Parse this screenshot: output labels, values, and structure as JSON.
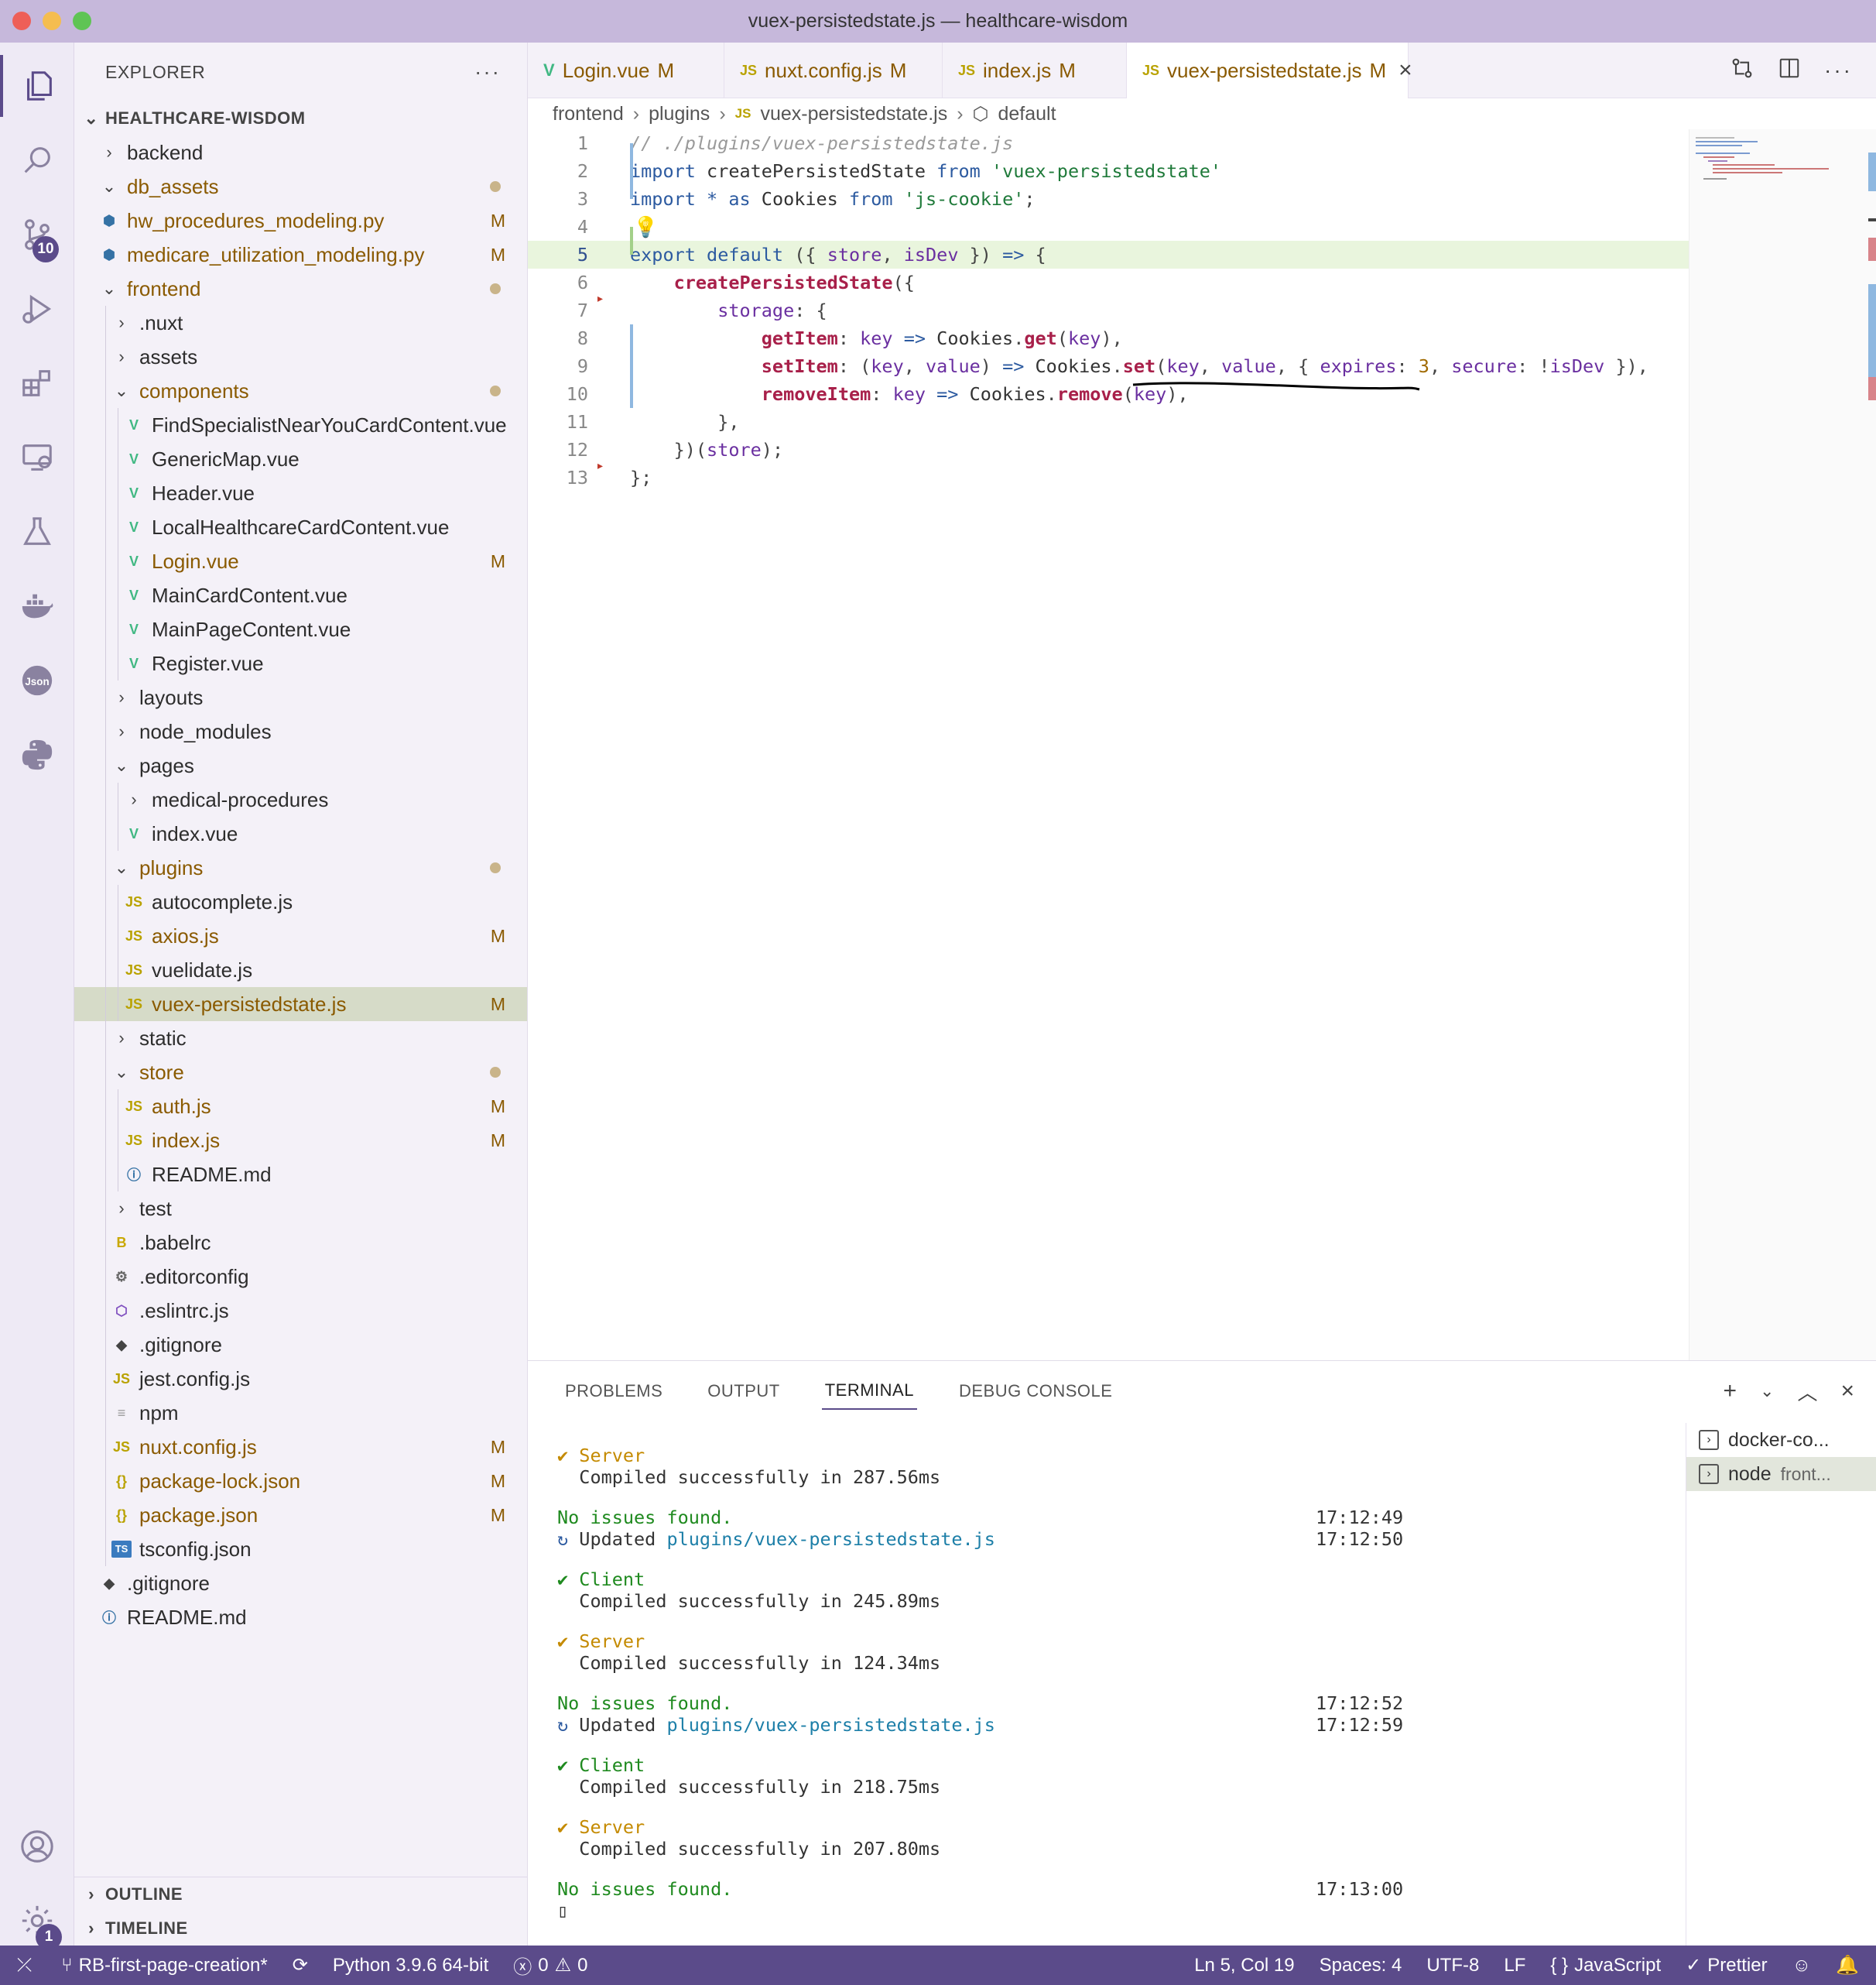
{
  "window": {
    "title": "vuex-persistedstate.js — healthcare-wisdom"
  },
  "activity": {
    "scm_badge": "10",
    "manage_badge": "1"
  },
  "sidebar": {
    "explorer_label": "EXPLORER",
    "more": "···",
    "root": "HEALTHCARE-WISDOM",
    "tree": [
      {
        "name": "backend",
        "type": "folder",
        "open": false,
        "depth": 1
      },
      {
        "name": "db_assets",
        "type": "folder",
        "open": true,
        "depth": 1,
        "mod": true,
        "dot": true
      },
      {
        "name": "hw_procedures_modeling.py",
        "type": "py",
        "depth": 1,
        "mod": true,
        "status": "M"
      },
      {
        "name": "medicare_utilization_modeling.py",
        "type": "py",
        "depth": 1,
        "mod": true,
        "status": "M"
      },
      {
        "name": "frontend",
        "type": "folder",
        "open": true,
        "depth": 1,
        "mod": true,
        "dot": true
      },
      {
        "name": ".nuxt",
        "type": "folder",
        "open": false,
        "depth": 2
      },
      {
        "name": "assets",
        "type": "folder",
        "open": false,
        "depth": 2
      },
      {
        "name": "components",
        "type": "folder",
        "open": true,
        "depth": 2,
        "mod": true,
        "dot": true
      },
      {
        "name": "FindSpecialistNearYouCardContent.vue",
        "type": "vue",
        "depth": 3
      },
      {
        "name": "GenericMap.vue",
        "type": "vue",
        "depth": 3
      },
      {
        "name": "Header.vue",
        "type": "vue",
        "depth": 3
      },
      {
        "name": "LocalHealthcareCardContent.vue",
        "type": "vue",
        "depth": 3
      },
      {
        "name": "Login.vue",
        "type": "vue",
        "depth": 3,
        "mod": true,
        "status": "M"
      },
      {
        "name": "MainCardContent.vue",
        "type": "vue",
        "depth": 3
      },
      {
        "name": "MainPageContent.vue",
        "type": "vue",
        "depth": 3
      },
      {
        "name": "Register.vue",
        "type": "vue",
        "depth": 3
      },
      {
        "name": "layouts",
        "type": "folder",
        "open": false,
        "depth": 2
      },
      {
        "name": "node_modules",
        "type": "folder",
        "open": false,
        "depth": 2
      },
      {
        "name": "pages",
        "type": "folder",
        "open": true,
        "depth": 2
      },
      {
        "name": "medical-procedures",
        "type": "folder",
        "open": false,
        "depth": 3
      },
      {
        "name": "index.vue",
        "type": "vue",
        "depth": 3
      },
      {
        "name": "plugins",
        "type": "folder",
        "open": true,
        "depth": 2,
        "mod": true,
        "dot": true
      },
      {
        "name": "autocomplete.js",
        "type": "js",
        "depth": 3
      },
      {
        "name": "axios.js",
        "type": "js",
        "depth": 3,
        "mod": true,
        "status": "M"
      },
      {
        "name": "vuelidate.js",
        "type": "js",
        "depth": 3
      },
      {
        "name": "vuex-persistedstate.js",
        "type": "js",
        "depth": 3,
        "mod": true,
        "status": "M",
        "selected": true
      },
      {
        "name": "static",
        "type": "folder",
        "open": false,
        "depth": 2
      },
      {
        "name": "store",
        "type": "folder",
        "open": true,
        "depth": 2,
        "mod": true,
        "dot": true
      },
      {
        "name": "auth.js",
        "type": "js",
        "depth": 3,
        "mod": true,
        "status": "M"
      },
      {
        "name": "index.js",
        "type": "js",
        "depth": 3,
        "mod": true,
        "status": "M"
      },
      {
        "name": "README.md",
        "type": "info",
        "depth": 3
      },
      {
        "name": "test",
        "type": "folder",
        "open": false,
        "depth": 2
      },
      {
        "name": ".babelrc",
        "type": "babel",
        "depth": 2
      },
      {
        "name": ".editorconfig",
        "type": "gear",
        "depth": 2
      },
      {
        "name": ".eslintrc.js",
        "type": "eslint",
        "depth": 2
      },
      {
        "name": ".gitignore",
        "type": "git",
        "depth": 2
      },
      {
        "name": "jest.config.js",
        "type": "js",
        "depth": 2
      },
      {
        "name": "npm",
        "type": "text",
        "depth": 2
      },
      {
        "name": "nuxt.config.js",
        "type": "js",
        "depth": 2,
        "mod": true,
        "status": "M"
      },
      {
        "name": "package-lock.json",
        "type": "json",
        "depth": 2,
        "mod": true,
        "status": "M"
      },
      {
        "name": "package.json",
        "type": "json",
        "depth": 2,
        "mod": true,
        "status": "M"
      },
      {
        "name": "tsconfig.json",
        "type": "ts",
        "depth": 2
      },
      {
        "name": ".gitignore",
        "type": "git",
        "depth": 1
      },
      {
        "name": "README.md",
        "type": "info",
        "depth": 1
      }
    ],
    "outline": "OUTLINE",
    "timeline": "TIMELINE"
  },
  "tabs": [
    {
      "name": "Login.vue",
      "icon": "V",
      "kind": "vue",
      "status": "M",
      "active": false
    },
    {
      "name": "nuxt.config.js",
      "icon": "JS",
      "kind": "js",
      "status": "M",
      "active": false
    },
    {
      "name": "index.js",
      "icon": "JS",
      "kind": "js",
      "status": "M",
      "active": false
    },
    {
      "name": "vuex-persistedstate.js",
      "icon": "JS",
      "kind": "js",
      "status": "M",
      "active": true
    }
  ],
  "breadcrumb": {
    "p1": "frontend",
    "p2": "plugins",
    "p3_icon": "JS",
    "p3": "vuex-persistedstate.js",
    "p4": "default"
  },
  "editor": {
    "current_line": 5,
    "lines": [
      [
        [
          "com",
          "// ./plugins/vuex-persistedstate.js"
        ]
      ],
      [
        [
          "kw",
          "import "
        ],
        [
          "var",
          "createPersistedState "
        ],
        [
          "kw",
          "from "
        ],
        [
          "str",
          "'vuex-persistedstate'"
        ]
      ],
      [
        [
          "kw",
          "import "
        ],
        [
          "kw",
          "* "
        ],
        [
          "kw",
          "as "
        ],
        [
          "var",
          "Cookies "
        ],
        [
          "kw",
          "from "
        ],
        [
          "str",
          "'js-cookie'"
        ],
        [
          "punc",
          ";"
        ]
      ],
      [],
      [
        [
          "kw",
          "export "
        ],
        [
          "kw",
          "default "
        ],
        [
          "punc",
          "({ "
        ],
        [
          "prop",
          "store"
        ],
        [
          "punc",
          ", "
        ],
        [
          "prop",
          "isDev"
        ],
        [
          "punc",
          " }) "
        ],
        [
          "kw",
          "=> "
        ],
        [
          "punc",
          "{"
        ]
      ],
      [
        [
          "var",
          "    "
        ],
        [
          "fn",
          "createPersistedState"
        ],
        [
          "punc",
          "({"
        ]
      ],
      [
        [
          "var",
          "        "
        ],
        [
          "prop",
          "storage"
        ],
        [
          "punc",
          ": {"
        ]
      ],
      [
        [
          "var",
          "            "
        ],
        [
          "fn",
          "getItem"
        ],
        [
          "punc",
          ": "
        ],
        [
          "prop",
          "key "
        ],
        [
          "kw",
          "=> "
        ],
        [
          "var",
          "Cookies"
        ],
        [
          "punc",
          "."
        ],
        [
          "fn",
          "get"
        ],
        [
          "punc",
          "("
        ],
        [
          "prop",
          "key"
        ],
        [
          "punc",
          "),"
        ]
      ],
      [
        [
          "var",
          "            "
        ],
        [
          "fn",
          "setItem"
        ],
        [
          "punc",
          ": ("
        ],
        [
          "prop",
          "key"
        ],
        [
          "punc",
          ", "
        ],
        [
          "prop",
          "value"
        ],
        [
          "punc",
          ") "
        ],
        [
          "kw",
          "=> "
        ],
        [
          "var",
          "Cookies"
        ],
        [
          "punc",
          "."
        ],
        [
          "fn",
          "set"
        ],
        [
          "punc",
          "("
        ],
        [
          "prop",
          "key"
        ],
        [
          "punc",
          ", "
        ],
        [
          "prop",
          "value"
        ],
        [
          "punc",
          ", { "
        ],
        [
          "prop",
          "expires"
        ],
        [
          "punc",
          ": "
        ],
        [
          "num",
          "3"
        ],
        [
          "punc",
          ", "
        ],
        [
          "prop",
          "secure"
        ],
        [
          "punc",
          ": !"
        ],
        [
          "prop",
          "isDev"
        ],
        [
          "punc",
          " }),"
        ]
      ],
      [
        [
          "var",
          "            "
        ],
        [
          "fn",
          "removeItem"
        ],
        [
          "punc",
          ": "
        ],
        [
          "prop",
          "key "
        ],
        [
          "kw",
          "=> "
        ],
        [
          "var",
          "Cookies"
        ],
        [
          "punc",
          "."
        ],
        [
          "fn",
          "remove"
        ],
        [
          "punc",
          "("
        ],
        [
          "prop",
          "key"
        ],
        [
          "punc",
          "),"
        ]
      ],
      [
        [
          "var",
          "        "
        ],
        [
          "punc",
          "},"
        ]
      ],
      [
        [
          "var",
          "    "
        ],
        [
          "punc",
          "})("
        ],
        [
          "prop",
          "store"
        ],
        [
          "punc",
          ");"
        ]
      ],
      [
        [
          "punc",
          "};"
        ]
      ]
    ]
  },
  "panel": {
    "tabs": [
      "PROBLEMS",
      "OUTPUT",
      "TERMINAL",
      "DEBUG CONSOLE"
    ],
    "active_tab": "TERMINAL",
    "terminals": [
      {
        "name": "docker-co...",
        "active": false
      },
      {
        "name": "node",
        "sub": "front...",
        "active": true
      }
    ],
    "terminal_lines": [
      {
        "segments": [
          [
            "warn",
            "✔ Server"
          ]
        ],
        "time": ""
      },
      {
        "segments": [
          [
            "text",
            "  Compiled successfully in 287.56ms"
          ]
        ],
        "time": ""
      },
      {
        "segments": [],
        "time": ""
      },
      {
        "segments": [
          [
            "ok",
            "No issues found."
          ]
        ],
        "time": "17:12:49"
      },
      {
        "segments": [
          [
            "blue",
            "↻ "
          ],
          [
            "text",
            "Updated "
          ],
          [
            "link",
            "plugins/vuex-persistedstate.js"
          ]
        ],
        "time": "17:12:50"
      },
      {
        "segments": [],
        "time": ""
      },
      {
        "segments": [
          [
            "ok",
            "✔ Client"
          ]
        ],
        "time": ""
      },
      {
        "segments": [
          [
            "text",
            "  Compiled successfully in 245.89ms"
          ]
        ],
        "time": ""
      },
      {
        "segments": [],
        "time": ""
      },
      {
        "segments": [
          [
            "warn",
            "✔ Server"
          ]
        ],
        "time": ""
      },
      {
        "segments": [
          [
            "text",
            "  Compiled successfully in 124.34ms"
          ]
        ],
        "time": ""
      },
      {
        "segments": [],
        "time": ""
      },
      {
        "segments": [
          [
            "ok",
            "No issues found."
          ]
        ],
        "time": "17:12:52"
      },
      {
        "segments": [
          [
            "blue",
            "↻ "
          ],
          [
            "text",
            "Updated "
          ],
          [
            "link",
            "plugins/vuex-persistedstate.js"
          ]
        ],
        "time": "17:12:59"
      },
      {
        "segments": [],
        "time": ""
      },
      {
        "segments": [
          [
            "ok",
            "✔ Client"
          ]
        ],
        "time": ""
      },
      {
        "segments": [
          [
            "text",
            "  Compiled successfully in 218.75ms"
          ]
        ],
        "time": ""
      },
      {
        "segments": [],
        "time": ""
      },
      {
        "segments": [
          [
            "warn",
            "✔ Server"
          ]
        ],
        "time": ""
      },
      {
        "segments": [
          [
            "text",
            "  Compiled successfully in 207.80ms"
          ]
        ],
        "time": ""
      },
      {
        "segments": [],
        "time": ""
      },
      {
        "segments": [
          [
            "ok",
            "No issues found."
          ]
        ],
        "time": "17:13:00"
      },
      {
        "segments": [
          [
            "text",
            "▯"
          ]
        ],
        "time": ""
      }
    ]
  },
  "statusbar": {
    "branch": "RB-first-page-creation*",
    "python": "Python 3.9.6 64-bit",
    "errors": "0",
    "warnings": "0",
    "position": "Ln 5, Col 19",
    "spaces": "Spaces: 4",
    "encoding": "UTF-8",
    "eol": "LF",
    "language": "JavaScript",
    "formatter": "Prettier"
  },
  "colors": {
    "accent": "#5b4b8a",
    "titlebar": "#c6b8db",
    "modified": "#8a5a00"
  }
}
